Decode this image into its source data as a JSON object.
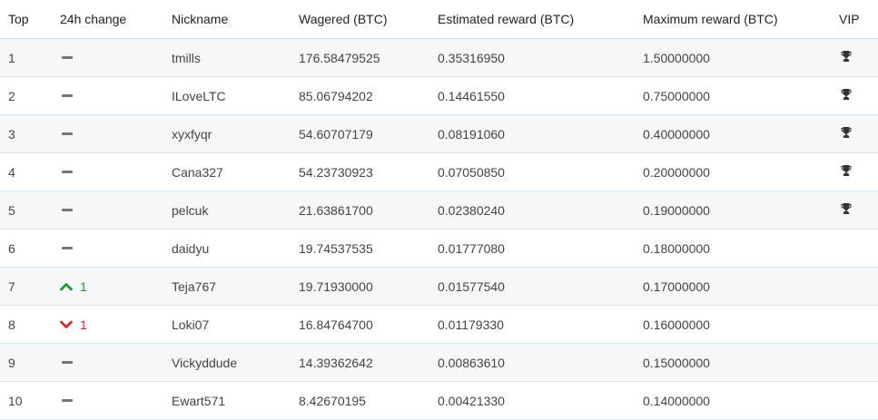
{
  "colors": {
    "up": "#1a9a2c",
    "down": "#e0262b",
    "dash": "#777777",
    "border": "#d5e5f2",
    "stripe": "#f5f7f9"
  },
  "icons": {
    "unchanged": "dash-icon",
    "up": "chevron-up-icon",
    "down": "chevron-down-icon",
    "vip": "trophy-icon"
  },
  "table": {
    "headers": {
      "top": "Top",
      "change": "24h change",
      "nickname": "Nickname",
      "wagered": "Wagered (BTC)",
      "estimated": "Estimated reward (BTC)",
      "maximum": "Maximum reward (BTC)",
      "vip": "VIP"
    },
    "rows": [
      {
        "top": "1",
        "change": "none",
        "change_value": "",
        "nickname": "tmills",
        "wagered": "176.58479525",
        "estimated": "0.35316950",
        "maximum": "1.50000000",
        "vip": true
      },
      {
        "top": "2",
        "change": "none",
        "change_value": "",
        "nickname": "ILoveLTC",
        "wagered": "85.06794202",
        "estimated": "0.14461550",
        "maximum": "0.75000000",
        "vip": true
      },
      {
        "top": "3",
        "change": "none",
        "change_value": "",
        "nickname": "xyxfyqr",
        "wagered": "54.60707179",
        "estimated": "0.08191060",
        "maximum": "0.40000000",
        "vip": true
      },
      {
        "top": "4",
        "change": "none",
        "change_value": "",
        "nickname": "Cana327",
        "wagered": "54.23730923",
        "estimated": "0.07050850",
        "maximum": "0.20000000",
        "vip": true
      },
      {
        "top": "5",
        "change": "none",
        "change_value": "",
        "nickname": "pelcuk",
        "wagered": "21.63861700",
        "estimated": "0.02380240",
        "maximum": "0.19000000",
        "vip": true
      },
      {
        "top": "6",
        "change": "none",
        "change_value": "",
        "nickname": "daidyu",
        "wagered": "19.74537535",
        "estimated": "0.01777080",
        "maximum": "0.18000000",
        "vip": false
      },
      {
        "top": "7",
        "change": "up",
        "change_value": "1",
        "nickname": "Teja767",
        "wagered": "19.71930000",
        "estimated": "0.01577540",
        "maximum": "0.17000000",
        "vip": false
      },
      {
        "top": "8",
        "change": "down",
        "change_value": "1",
        "nickname": "Loki07",
        "wagered": "16.84764700",
        "estimated": "0.01179330",
        "maximum": "0.16000000",
        "vip": false
      },
      {
        "top": "9",
        "change": "none",
        "change_value": "",
        "nickname": "Vickyddude",
        "wagered": "14.39362642",
        "estimated": "0.00863610",
        "maximum": "0.15000000",
        "vip": false
      },
      {
        "top": "10",
        "change": "none",
        "change_value": "",
        "nickname": "Ewart571",
        "wagered": "8.42670195",
        "estimated": "0.00421330",
        "maximum": "0.14000000",
        "vip": false
      }
    ]
  }
}
